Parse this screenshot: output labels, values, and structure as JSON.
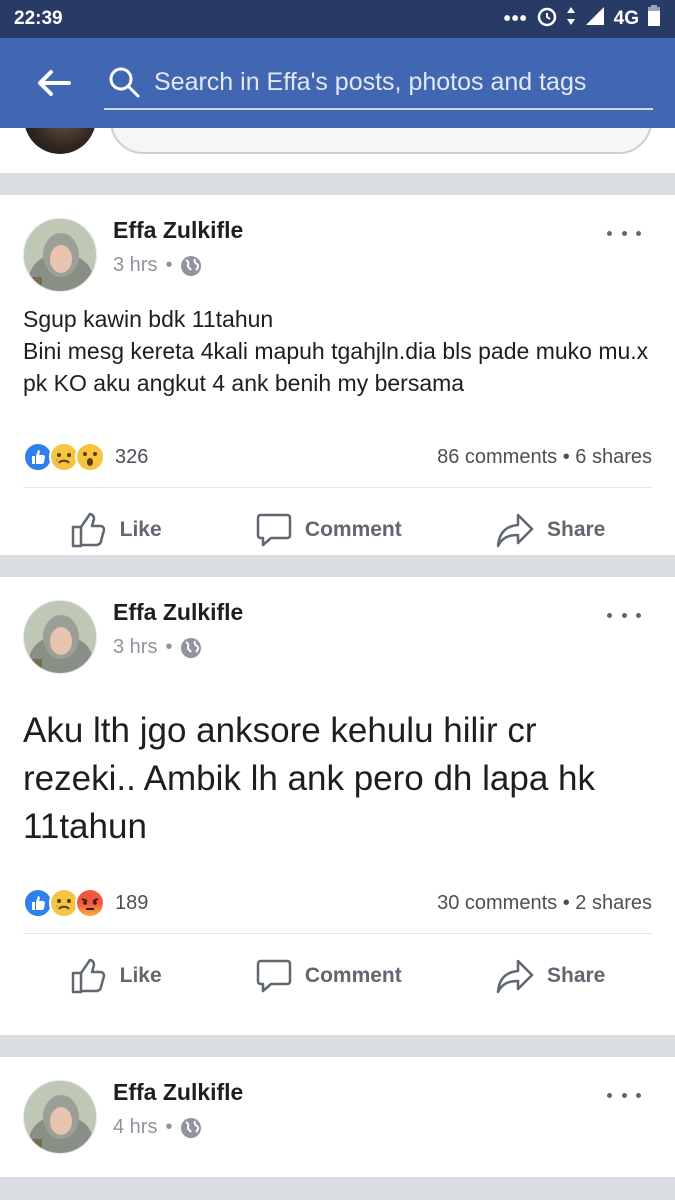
{
  "status_bar": {
    "time": "22:39",
    "network": "4G"
  },
  "header": {
    "search_placeholder": "Search in Effa's posts, photos and tags"
  },
  "posts": [
    {
      "author": "Effa Zulkifle",
      "time": "3 hrs",
      "text": "Sgup kawin bdk 11tahun\nBini mesg kereta 4kali mapuh tgahjln.dia bls pade muko mu.x pk KO aku angkut 4 ank benih my bersama",
      "reactions": [
        "like-icon",
        "sad-icon",
        "wow-icon"
      ],
      "reaction_count": "326",
      "comments": "86 comments",
      "shares": "6 shares"
    },
    {
      "author": "Effa Zulkifle",
      "time": "3 hrs",
      "text": "Aku lth jgo anksore kehulu hilir cr rezeki.. Ambik lh ank pero dh lapa hk 11tahun",
      "reactions": [
        "like-icon",
        "sad-icon",
        "angry-icon"
      ],
      "reaction_count": "189",
      "comments": "30 comments",
      "shares": "2 shares"
    },
    {
      "author": "Effa Zulkifle",
      "time": "4 hrs"
    }
  ],
  "actions": {
    "like": "Like",
    "comment": "Comment",
    "share": "Share"
  },
  "colors": {
    "status_bar": "#283a66",
    "header": "#4267b2",
    "like_blue": "#2f80ed"
  }
}
